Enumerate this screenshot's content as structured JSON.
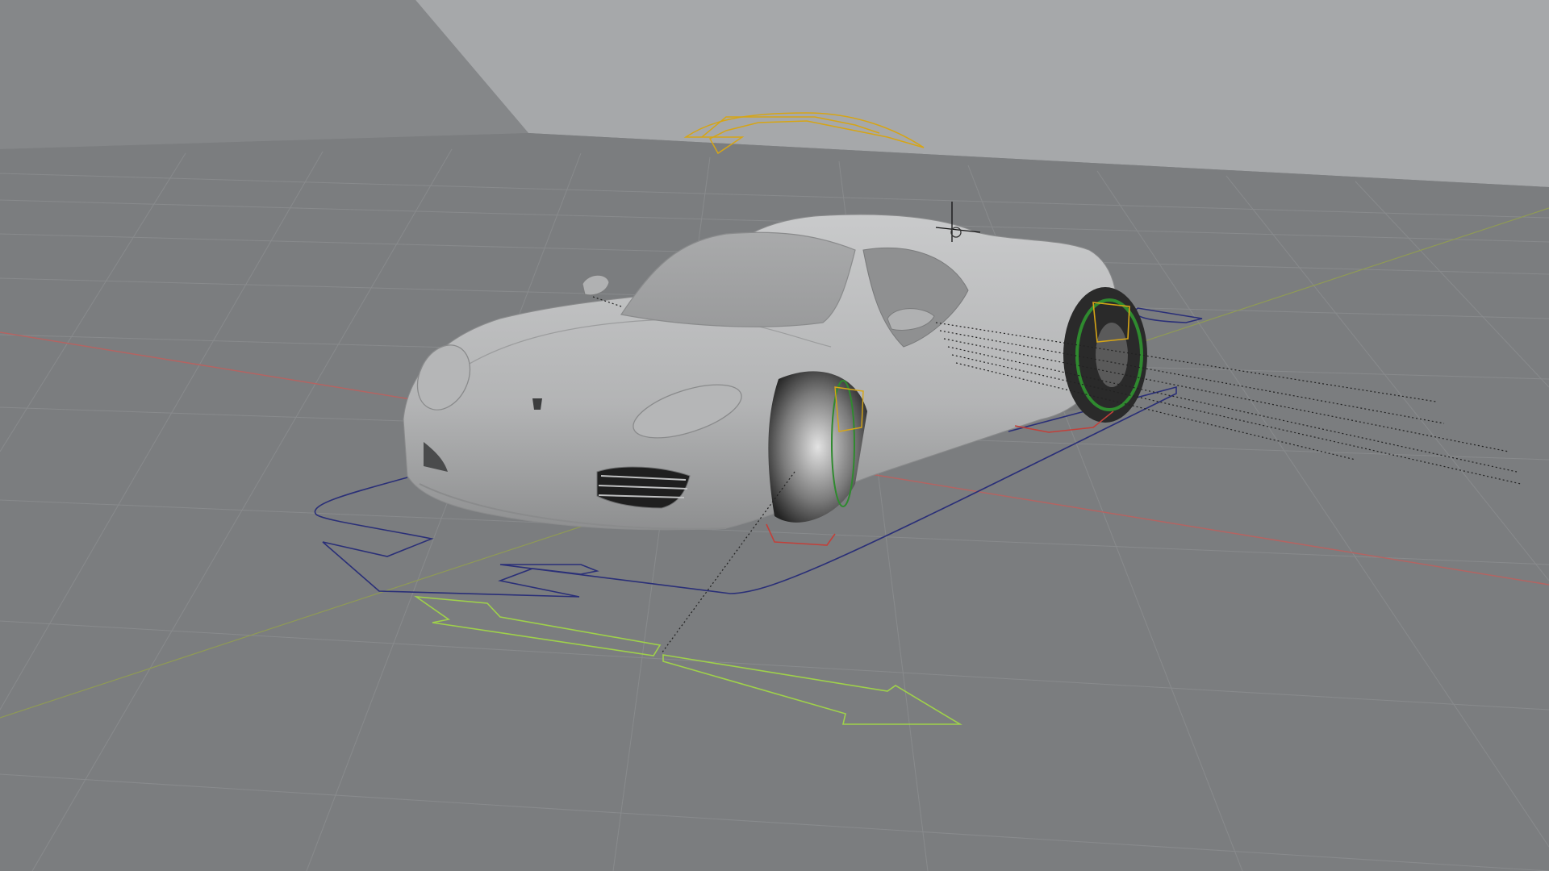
{
  "viewport": {
    "mode": "3D Viewport",
    "shading": "solid",
    "scene_object": "car-rig"
  },
  "colors": {
    "background": "#7f8183",
    "floor": "#7b7d7f",
    "wall_upper": "#a6a8aa",
    "grid_line": "#8c8e90",
    "x_axis": "#b46462",
    "y_axis": "#8f9a55",
    "controller_blue": "#2a2f78",
    "controller_green": "#9fd14a",
    "controller_yellow": "#d6a516",
    "controller_red": "#c2403a",
    "wheel_ring_green": "#2f8a2f",
    "car_body": "#b8b9ba"
  },
  "icons": {
    "cursor": "3d-cursor-icon"
  }
}
